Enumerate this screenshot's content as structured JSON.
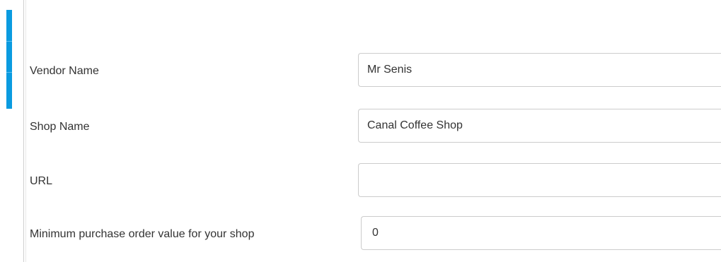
{
  "accent_color": "#0a9be0",
  "form": {
    "fields": [
      {
        "label": "Vendor Name",
        "value": "Mr Senis",
        "placeholder": ""
      },
      {
        "label": "Shop Name",
        "value": "Canal Coffee Shop",
        "placeholder": ""
      },
      {
        "label": "URL",
        "value": "",
        "placeholder": ""
      },
      {
        "label": "Minimum purchase order value for your shop",
        "value": "0",
        "placeholder": ""
      }
    ]
  }
}
